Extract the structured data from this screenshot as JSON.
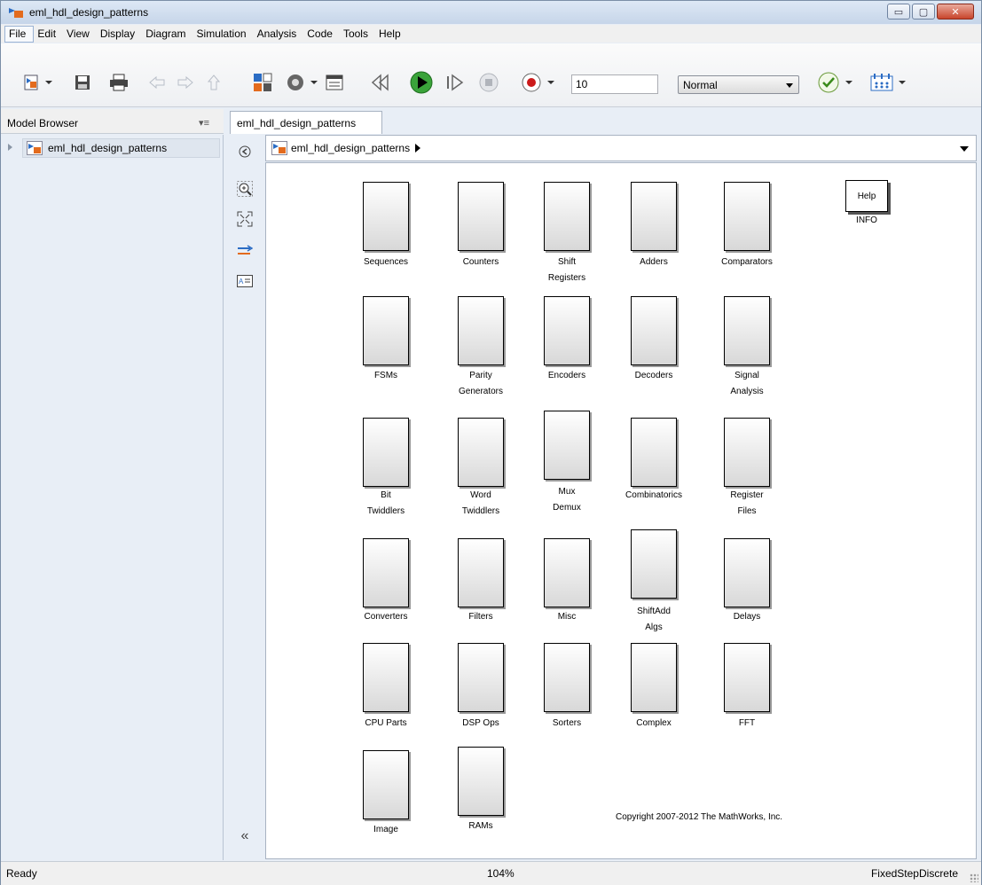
{
  "window": {
    "title": "eml_hdl_design_patterns",
    "min_glyph": "▭",
    "max_glyph": "▢",
    "close_glyph": "✕"
  },
  "menu": [
    "File",
    "Edit",
    "View",
    "Display",
    "Diagram",
    "Simulation",
    "Analysis",
    "Code",
    "Tools",
    "Help"
  ],
  "toolbar": {
    "stop_time": "10",
    "sim_mode": "Normal",
    "icons": [
      "new-model-icon",
      "save-icon",
      "print-icon",
      "back-icon",
      "forward-icon",
      "up-icon",
      "library-browser-icon",
      "model-config-icon",
      "model-explorer-icon",
      "step-back-icon",
      "run-icon",
      "step-forward-icon",
      "stop-icon",
      "record-icon",
      "check-icon",
      "build-icon"
    ]
  },
  "model_browser": {
    "header": "Model Browser",
    "menu_glyph": "▾≡",
    "tree_item": "eml_hdl_design_patterns"
  },
  "tab": {
    "label": "eml_hdl_design_patterns"
  },
  "address": {
    "path": "eml_hdl_design_patterns"
  },
  "sidebar": {
    "collapse_glyph": "«"
  },
  "blocks": [
    "Sequences",
    "Counters",
    "Shift\nRegisters",
    "Adders",
    "Comparators",
    "FSMs",
    "Parity\nGenerators",
    "Encoders",
    "Decoders",
    "Signal\nAnalysis",
    "Bit\nTwiddlers",
    "Word\nTwiddlers",
    "Mux\nDemux",
    "Combinatorics",
    "Register\nFiles",
    "Converters",
    "Filters",
    "Misc",
    "ShiftAdd\nAlgs",
    "Delays",
    "CPU Parts",
    "DSP Ops",
    "Sorters",
    "Complex",
    "FFT",
    "Image",
    "RAMs"
  ],
  "help_block": {
    "text": "Help",
    "label": "INFO"
  },
  "copyright": "Copyright 2007-2012 The MathWorks, Inc.",
  "status": {
    "ready": "Ready",
    "zoom": "104%",
    "solver": "FixedStepDiscrete"
  },
  "colors": {
    "run_green": "#3aa33a",
    "record_red": "#cc1a1a",
    "accent_blue": "#2b6cc4"
  }
}
